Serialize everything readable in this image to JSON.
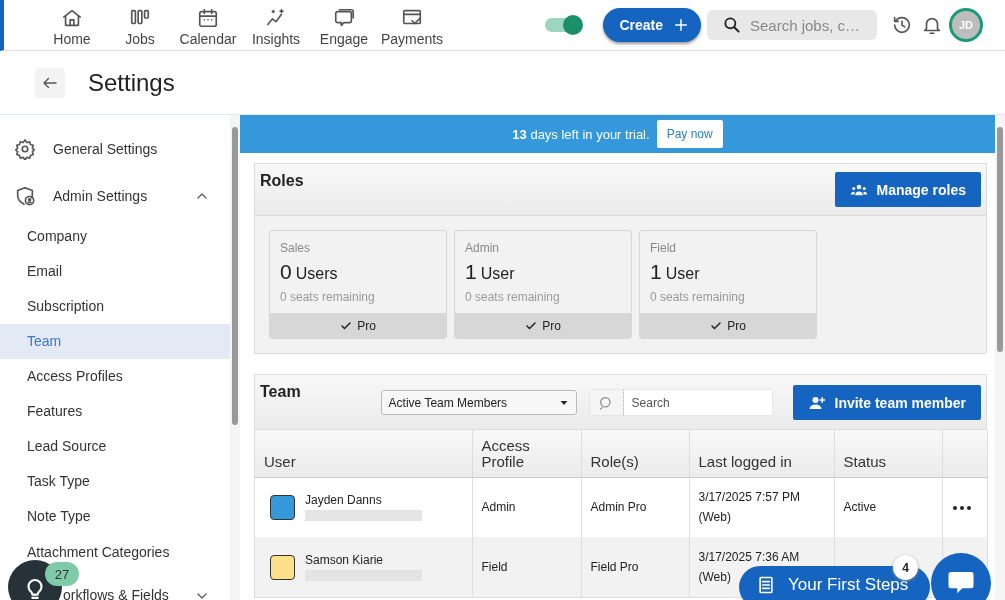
{
  "nav": {
    "items": [
      {
        "label": "Home"
      },
      {
        "label": "Jobs"
      },
      {
        "label": "Calendar"
      },
      {
        "label": "Insights"
      },
      {
        "label": "Engage"
      },
      {
        "label": "Payments"
      }
    ]
  },
  "toggle": {
    "on": true
  },
  "create_button": "Create",
  "search": {
    "placeholder": "Search jobs, c…"
  },
  "avatar": "JD",
  "page_title": "Settings",
  "sidebar": {
    "items": [
      {
        "label": "General Settings"
      },
      {
        "label": "Admin Settings",
        "expanded": true,
        "children": [
          {
            "label": "Company",
            "selected": false
          },
          {
            "label": "Email",
            "selected": false
          },
          {
            "label": "Subscription",
            "selected": false
          },
          {
            "label": "Team",
            "selected": true
          },
          {
            "label": "Access Profiles",
            "selected": false
          },
          {
            "label": "Features",
            "selected": false
          },
          {
            "label": "Lead Source",
            "selected": false
          },
          {
            "label": "Task Type",
            "selected": false
          },
          {
            "label": "Note Type",
            "selected": false
          },
          {
            "label": "Attachment Categories",
            "selected": false
          }
        ]
      },
      {
        "label": "orkflows & Fields",
        "expanded": false
      }
    ]
  },
  "banner": {
    "text": "**13** days left in your trial.",
    "button": "Pay now"
  },
  "roles": {
    "title": "Roles",
    "button": "Manage roles",
    "cards": [
      {
        "name": "Sales",
        "count": "0",
        "unit": "Users",
        "seats": "0 seats remaining",
        "plan": "Pro"
      },
      {
        "name": "Admin",
        "count": "1",
        "unit": "User",
        "seats": "0 seats remaining",
        "plan": "Pro"
      },
      {
        "name": "Field",
        "count": "1",
        "unit": "User",
        "seats": "0 seats remaining",
        "plan": "Pro"
      }
    ]
  },
  "team": {
    "title": "Team",
    "filter": "Active Team Members",
    "search_placeholder": "Search",
    "button": "Invite team member",
    "columns": [
      "User",
      "Access Profile",
      "Role(s)",
      "Last logged in",
      "Status"
    ],
    "rows": [
      {
        "name": "Jayden Danns",
        "color": "#3498db",
        "access_profile": "Admin",
        "roles": "Admin Pro",
        "last_login": "3/17/2025 7:57 PM",
        "login_via": "(Web)",
        "status": "Active"
      },
      {
        "name": "Samson Kiarie",
        "color": "#ffe08a",
        "access_profile": "Field",
        "roles": "Field Pro",
        "last_login": "3/17/2025 7:36 AM",
        "login_via": "(Web)"
      }
    ]
  },
  "tips": {
    "badge": "27"
  },
  "first_steps": {
    "label": "Your First Steps",
    "badge": "4"
  }
}
